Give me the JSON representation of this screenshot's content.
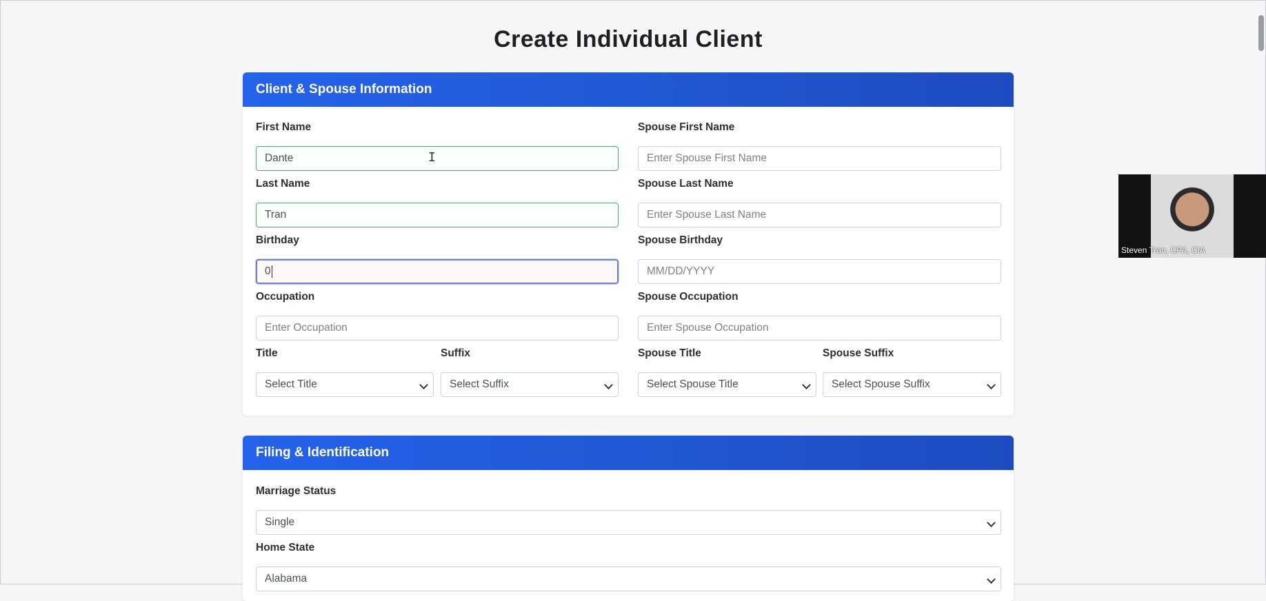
{
  "page": {
    "title": "Create Individual Client"
  },
  "section1": {
    "header": "Client & Spouse Information",
    "first_name": {
      "label": "First Name",
      "value": "Dante"
    },
    "last_name": {
      "label": "Last Name",
      "value": "Tran"
    },
    "birthday": {
      "label": "Birthday",
      "value": "0"
    },
    "occupation": {
      "label": "Occupation",
      "placeholder": "Enter Occupation"
    },
    "title": {
      "label": "Title",
      "selected": "Select Title"
    },
    "suffix": {
      "label": "Suffix",
      "selected": "Select Suffix"
    },
    "spouse_first_name": {
      "label": "Spouse First Name",
      "placeholder": "Enter Spouse First Name"
    },
    "spouse_last_name": {
      "label": "Spouse Last Name",
      "placeholder": "Enter Spouse Last Name"
    },
    "spouse_birthday": {
      "label": "Spouse Birthday",
      "placeholder": "MM/DD/YYYY"
    },
    "spouse_occupation": {
      "label": "Spouse Occupation",
      "placeholder": "Enter Spouse Occupation"
    },
    "spouse_title": {
      "label": "Spouse Title",
      "selected": "Select Spouse Title"
    },
    "spouse_suffix": {
      "label": "Spouse Suffix",
      "selected": "Select Spouse Suffix"
    }
  },
  "section2": {
    "header": "Filing & Identification",
    "marriage_status": {
      "label": "Marriage Status",
      "selected": "Single"
    },
    "home_state": {
      "label": "Home State",
      "selected": "Alabama"
    }
  },
  "video": {
    "participant_name": "Steven Tran, CPA, CIA"
  },
  "colors": {
    "accent": "#2563eb",
    "valid": "#4ba86b",
    "focus": "#6b7fd6"
  }
}
